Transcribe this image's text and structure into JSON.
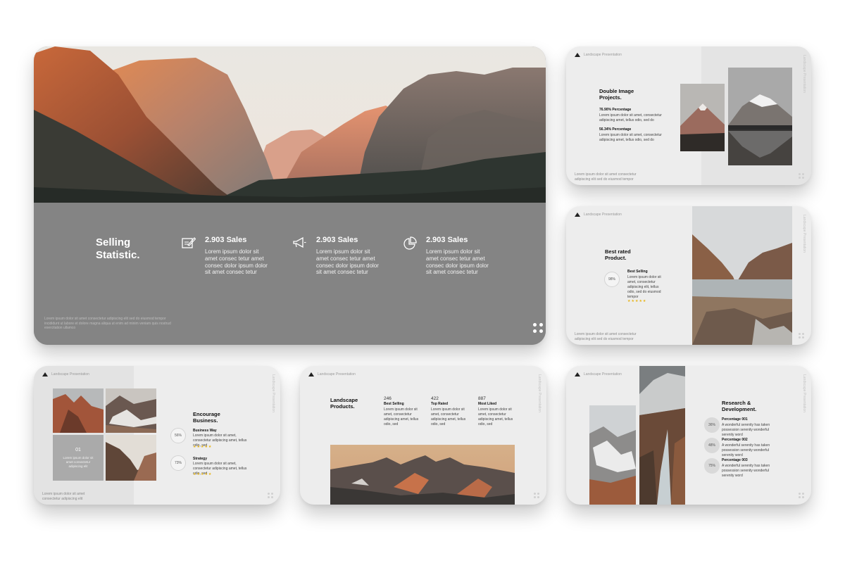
{
  "slide1": {
    "title_line1": "Selling",
    "title_line2": "Statistic.",
    "stats": [
      {
        "icon": "edit-icon",
        "value": "2.903 Sales",
        "text": "Lorem  ipsum dolor sit amet  consec tetur amet  consec dolor ipsum dolor sit amet consec tetur"
      },
      {
        "icon": "megaphone-icon",
        "value": "2.903 Sales",
        "text": "Lorem  ipsum dolor sit amet  consec tetur amet  consec dolor ipsum dolor sit amet consec tetur"
      },
      {
        "icon": "pie-chart-icon",
        "value": "2.903 Sales",
        "text": "Lorem  ipsum dolor sit amet  consec tetur amet  consec dolor ipsum dolor sit amet consec tetur"
      }
    ],
    "footer": "Lorem ipsum dolor sit amet consectetur adipiscing elit sed do eiusmod tempor incididunt ut labore et dolore magna aliqua ut enim ad minim veniam quis nostrud exercitation ullamco"
  },
  "slide2": {
    "header": "Landscape Presentation",
    "side": "Landscape Presentation",
    "title_line1": "Double Image",
    "title_line2": "Projects.",
    "items": [
      {
        "label": "76.90% Percentage",
        "text": "Lorem ipsum dolor sit amet, consectetur adipiscing amet, tellus odio, sed do"
      },
      {
        "label": "56.34% Percentage",
        "text": "Lorem ipsum dolor sit amet, consectetur adipiscing amet, tellus odio, sed do"
      }
    ],
    "footer": "Lorem ipsum dolor sit amet consectetur adipiscing elit sed do eiusmod tempor"
  },
  "slide3": {
    "header": "Landscape Presentation",
    "side": "Landscape Presentation",
    "title_line1": "Best rated",
    "title_line2": "Product.",
    "percent": "98%",
    "label": "Best Selling",
    "text": "Lorem ipsum dolor sit amet, consectetur adipiscing elit, tellus odio, sed do eiusmod tempor",
    "stars": "★★★★★",
    "footer": "Lorem ipsum dolor sit amet consectetur adipiscing elit sed do eiusmod tempor"
  },
  "slide4": {
    "header": "Landscape Presentation",
    "side": "Landscape Presentation",
    "tile_number": "01",
    "tile_text": "Lorem ipsum dolor sit amet consectetur adipiscing elit",
    "title_line1": "Encourage",
    "title_line2": "Business.",
    "items": [
      {
        "percent": "56%",
        "label": "Business Way",
        "text": "Lorem ipsum dolor sit amet, consectetur adipiscing amet, tellus odio, sed",
        "stars": "★★★★★"
      },
      {
        "percent": "73%",
        "label": "Strategy",
        "text": "Lorem ipsum dolor sit amet, consectetur adipiscing amet, tellus odio, sed",
        "stars": "★★★★★"
      }
    ],
    "footer": "Lorem ipsum dolor sit amet consectetur adipiscing elit"
  },
  "slide5": {
    "header": "Landscape Presentation",
    "side": "Landscape Presentation",
    "title_line1": "Landscape",
    "title_line2": "Products.",
    "stats": [
      {
        "value": "246",
        "label": "Best Selling",
        "text": "Lorem ipsum dolor sit amet, consectetur adipiscing amet, tellus odio, sed"
      },
      {
        "value": "422",
        "label": "Top Rated",
        "text": "Lorem ipsum dolor sit amet, consectetur adipiscing amet, tellus odio, sed"
      },
      {
        "value": "887",
        "label": "Most Liked",
        "text": "Lorem ipsum dolor sit amet, consectetur adipiscing amet, tellus odio, sed"
      }
    ]
  },
  "slide6": {
    "header": "Landscape Presentation",
    "side": "Landscape Presentation",
    "title_line1": "Research &",
    "title_line2": "Development.",
    "items": [
      {
        "percent": "36%",
        "label": "Percentage 001",
        "text": "A wonderful serenity has taken possession serenity wonderful serenity word"
      },
      {
        "percent": "48%",
        "label": "Percentage 002",
        "text": "A wonderful serenity has taken possession serenity wonderful serenity word"
      },
      {
        "percent": "75%",
        "label": "Percentage 003",
        "text": "A wonderful serenity has taken possession serenity wonderful serenity word"
      }
    ]
  }
}
